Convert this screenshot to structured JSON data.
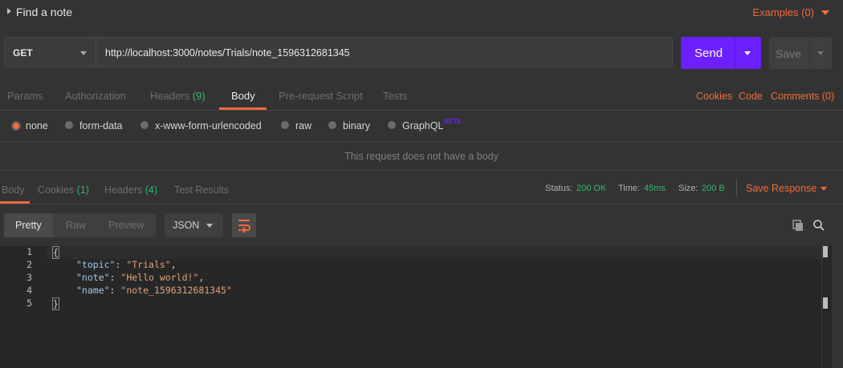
{
  "request": {
    "title": "Find a note",
    "examples": "Examples (0)",
    "method": "GET",
    "url": "http://localhost:3000/notes/Trials/note_1596312681345",
    "send": "Send",
    "save": "Save"
  },
  "req_tabs": {
    "params": "Params",
    "authorization": "Authorization",
    "headers": "Headers",
    "headers_count": "(9)",
    "body": "Body",
    "prerequest": "Pre-request Script",
    "tests": "Tests",
    "cookies": "Cookies",
    "code": "Code",
    "comments": "Comments (0)"
  },
  "body_types": {
    "none": "none",
    "form_data": "form-data",
    "urlencoded": "x-www-form-urlencoded",
    "raw": "raw",
    "binary": "binary",
    "graphql": "GraphQL",
    "beta": "BETA",
    "selected": "none"
  },
  "no_body_message": "This request does not have a body",
  "response": {
    "tabs": {
      "body": "Body",
      "cookies": "Cookies",
      "cookies_count": "(1)",
      "headers": "Headers",
      "headers_count": "(4)",
      "test_results": "Test Results"
    },
    "status_label": "Status:",
    "status_value": "200 OK",
    "time_label": "Time:",
    "time_value": "45ms",
    "size_label": "Size:",
    "size_value": "200 B",
    "save_response": "Save Response",
    "views": {
      "pretty": "Pretty",
      "raw": "Raw",
      "preview": "Preview"
    },
    "format": "JSON",
    "lines": {
      "n1": "1",
      "n2": "2",
      "n3": "3",
      "n4": "4",
      "n5": "5",
      "open": "{",
      "close": "}",
      "k1": "\"topic\"",
      "v1": "\"Trials\"",
      "k2": "\"note\"",
      "v2": "\"Hello world!\"",
      "k3": "\"name\"",
      "v3": "\"note_1596312681345\""
    }
  },
  "colors": {
    "accent": "#f26b3a",
    "send": "#6c20ff",
    "count_green": "#2fba6b"
  }
}
